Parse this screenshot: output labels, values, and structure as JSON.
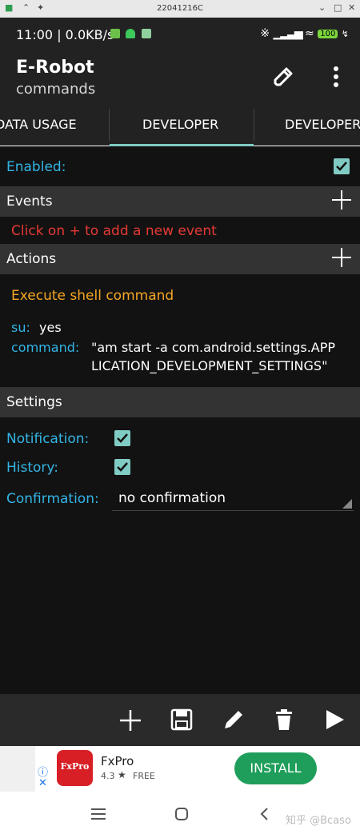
{
  "window": {
    "title": "22041216C"
  },
  "status_bar": {
    "time_speed": "11:00 | 0.0KB/s",
    "battery": "100"
  },
  "app_bar": {
    "title": "E-Robot",
    "subtitle": "commands"
  },
  "tabs": [
    {
      "label": "DATA USAGE"
    },
    {
      "label": "DEVELOPER"
    },
    {
      "label": "DEVELOPER"
    }
  ],
  "enabled_label": "Enabled:",
  "events": {
    "header": "Events",
    "empty_hint": "Click on + to add a new event"
  },
  "actions": {
    "header": "Actions",
    "action_title": "Execute shell command",
    "su_label": "su:",
    "su_value": "yes",
    "command_label": "command:",
    "command_value_line1": "\"am start -a com.android.settings.APP",
    "command_value_line2": "LICATION_DEVELOPMENT_SETTINGS\""
  },
  "settings": {
    "header": "Settings",
    "notification_label": "Notification:",
    "history_label": "History:",
    "confirmation_label": "Confirmation:",
    "confirmation_value": "no confirmation"
  },
  "ad": {
    "app_name": "FxPro",
    "logo_text": "FxPro",
    "rating": "4.3",
    "price": "FREE",
    "install_label": "INSTALL"
  },
  "watermark": "知乎 @Bcaso",
  "colors": {
    "accent": "#80cbc4",
    "label_blue": "#33b5e5",
    "warning_red": "#e53935",
    "action_orange": "#f5a623",
    "install_green": "#1e9e5a"
  }
}
